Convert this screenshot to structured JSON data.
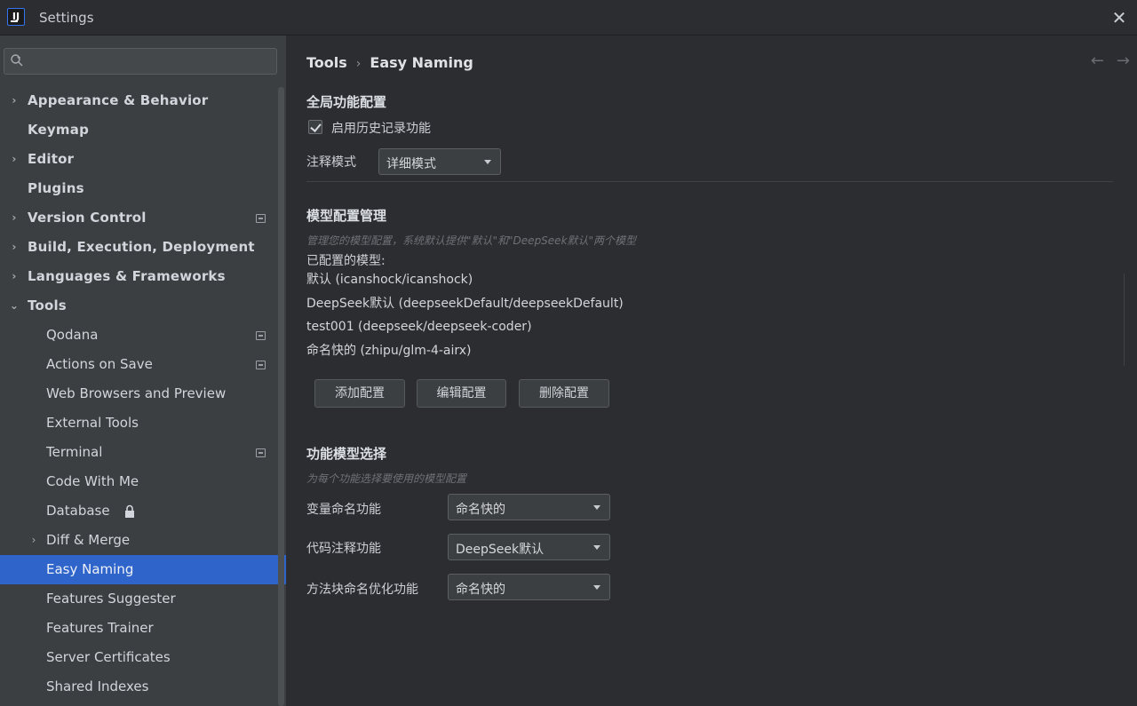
{
  "window": {
    "title": "Settings",
    "close": "✕"
  },
  "search": {
    "placeholder": "",
    "value": ""
  },
  "sidebar": {
    "items": [
      {
        "label": "Appearance & Behavior",
        "level": 0,
        "chevron": "›",
        "bold": true
      },
      {
        "label": "Keymap",
        "level": 0,
        "chevron": "",
        "bold": true
      },
      {
        "label": "Editor",
        "level": 0,
        "chevron": "›",
        "bold": true
      },
      {
        "label": "Plugins",
        "level": 0,
        "chevron": "",
        "bold": true
      },
      {
        "label": "Version Control",
        "level": 0,
        "chevron": "›",
        "bold": true,
        "badge": true
      },
      {
        "label": "Build, Execution, Deployment",
        "level": 0,
        "chevron": "›",
        "bold": true
      },
      {
        "label": "Languages & Frameworks",
        "level": 0,
        "chevron": "›",
        "bold": true
      },
      {
        "label": "Tools",
        "level": 0,
        "chevron": "⌄",
        "bold": true
      },
      {
        "label": "Qodana",
        "level": 1,
        "chevron": "",
        "badge": true
      },
      {
        "label": "Actions on Save",
        "level": 1,
        "chevron": "",
        "badge": true
      },
      {
        "label": "Web Browsers and Preview",
        "level": 1,
        "chevron": ""
      },
      {
        "label": "External Tools",
        "level": 1,
        "chevron": ""
      },
      {
        "label": "Terminal",
        "level": 1,
        "chevron": "",
        "badge": true
      },
      {
        "label": "Code With Me",
        "level": 1,
        "chevron": ""
      },
      {
        "label": "Database",
        "level": 1,
        "chevron": "",
        "lock": true
      },
      {
        "label": "Diff & Merge",
        "level": 1,
        "chevron": "›"
      },
      {
        "label": "Easy Naming",
        "level": 1,
        "chevron": "",
        "selected": true
      },
      {
        "label": "Features Suggester",
        "level": 1,
        "chevron": ""
      },
      {
        "label": "Features Trainer",
        "level": 1,
        "chevron": ""
      },
      {
        "label": "Server Certificates",
        "level": 1,
        "chevron": ""
      },
      {
        "label": "Shared Indexes",
        "level": 1,
        "chevron": ""
      }
    ]
  },
  "breadcrumb": {
    "parent": "Tools",
    "separator": "›",
    "current": "Easy Naming"
  },
  "nav": {
    "back": "←",
    "forward": "→"
  },
  "global_config": {
    "title": "全局功能配置",
    "history_checkbox_label": "启用历史记录功能",
    "history_checked": true,
    "comment_mode_label": "注释模式",
    "comment_mode_value": "详细模式"
  },
  "model_config": {
    "title": "模型配置管理",
    "hint": "管理您的模型配置，系统默认提供\"默认\"和\"DeepSeek默认\"两个模型",
    "list_label": "已配置的模型:",
    "models": [
      "默认 (icanshock/icanshock)",
      "DeepSeek默认 (deepseekDefault/deepseekDefault)",
      "test001 (deepseek/deepseek-coder)",
      "命名快的 (zhipu/glm-4-airx)"
    ],
    "add_button": "添加配置",
    "edit_button": "编辑配置",
    "delete_button": "删除配置"
  },
  "feature_model": {
    "title": "功能模型选择",
    "hint": "为每个功能选择要使用的模型配置",
    "rows": [
      {
        "label": "变量命名功能",
        "value": "命名快的"
      },
      {
        "label": "代码注释功能",
        "value": "DeepSeek默认"
      },
      {
        "label": "方法块命名优化功能",
        "value": "命名快的"
      }
    ]
  },
  "colors": {
    "selection": "#2f65ca",
    "sidebar_bg": "#3c3f41",
    "content_bg": "#2b2d30"
  }
}
